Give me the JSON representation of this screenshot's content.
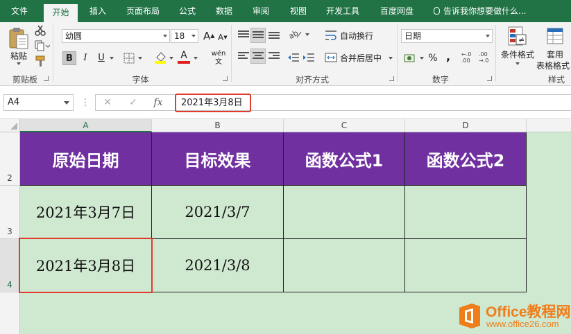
{
  "ribbon_tabs": [
    "文件",
    "开始",
    "插入",
    "页面布局",
    "公式",
    "数据",
    "审阅",
    "视图",
    "开发工具",
    "百度网盘"
  ],
  "active_tab": "开始",
  "tell_me": "告诉我你想要做什么...",
  "clipboard": {
    "paste": "粘贴",
    "group": "剪贴板"
  },
  "font": {
    "name": "幼圆",
    "size": "18",
    "bold": "B",
    "italic": "I",
    "underline": "U",
    "font_color": "A",
    "phonetic": "wén",
    "group": "字体"
  },
  "alignment": {
    "wrap": "自动换行",
    "merge": "合并后居中",
    "group": "对齐方式"
  },
  "number": {
    "format": "日期",
    "percent": "%",
    "comma": ",",
    "group": "数字"
  },
  "styles": {
    "conditional": "条件格式",
    "table_1": "套用",
    "table_2": "表格格式",
    "group": "样式"
  },
  "formula_bar": {
    "name_box": "A4",
    "formula": "2021年3月8日",
    "fx": "fx"
  },
  "columns": [
    "A",
    "B",
    "C",
    "D"
  ],
  "rows": [
    "2",
    "3",
    "4"
  ],
  "table": {
    "headers": [
      "原始日期",
      "目标效果",
      "函数公式1",
      "函数公式2"
    ],
    "rows": [
      [
        "2021年3月7日",
        "2021/3/7",
        "",
        ""
      ],
      [
        "2021年3月8日",
        "2021/3/8",
        "",
        ""
      ]
    ]
  },
  "watermark": {
    "title": "Office教程网",
    "url": "www.office26.com"
  },
  "colors": {
    "accent": "#217346",
    "header_fill": "#7030a0",
    "cell_fill": "#cfe8d0",
    "highlight": "#e23a2e",
    "watermark": "#ef7d1a"
  }
}
